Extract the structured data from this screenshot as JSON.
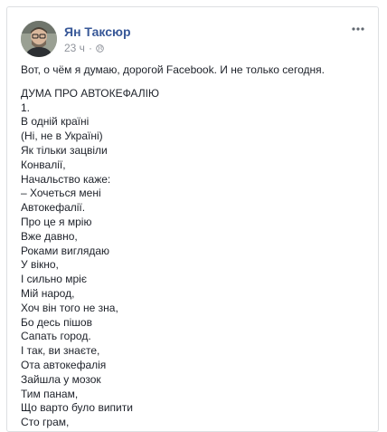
{
  "post": {
    "author": "Ян Таксюр",
    "time": "23 ч",
    "separator": "·",
    "privacy_icon": "globe-icon",
    "menu_icon": "more-options-icon",
    "intro": "Вот, о чём я думаю, дорогой Facebook. И не только сегодня.",
    "poem_lines": [
      "ДУМА ПРО АВТОКЕФАЛІЮ",
      "1.",
      "В одній країні",
      "(Ні, не в Україні)",
      "Як тільки зацвіли",
      "Конвалії,",
      "Начальство каже:",
      "– Хочеться мені",
      "Автокефалії.",
      "Про це я мрію",
      "Вже давно,",
      "Роками виглядаю",
      "У вікно,",
      "І сильно мріє",
      "Мій народ,",
      "Хоч він того не зна,",
      "Бо десь пішов",
      "Сапать город.",
      "І так, ви знаєте,",
      "Ота автокефалія",
      "Зайшла у мозок",
      "Тим панам,",
      "Що варто було випити",
      "Сто грам,"
    ]
  },
  "colors": {
    "author": "#385898",
    "meta": "#90949c",
    "text": "#1d2129",
    "border": "#dddfe2"
  }
}
